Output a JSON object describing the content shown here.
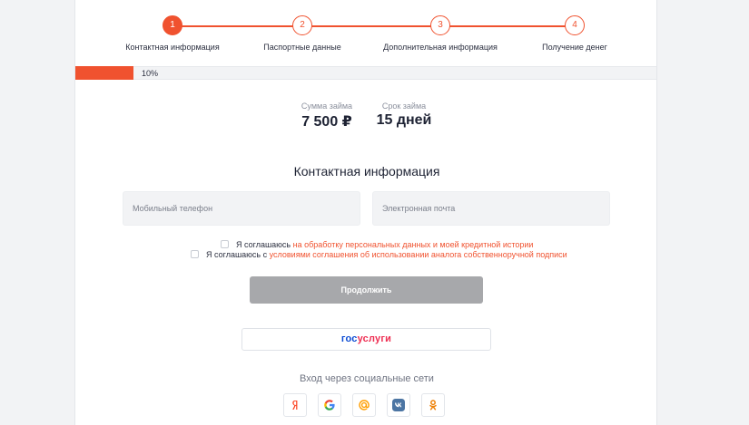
{
  "stepper": {
    "steps": [
      {
        "number": "1",
        "label": "Контактная информация"
      },
      {
        "number": "2",
        "label": "Паспортные данные"
      },
      {
        "number": "3",
        "label": "Дополнительная информация"
      },
      {
        "number": "4",
        "label": "Получение денег"
      }
    ],
    "active_step": 1
  },
  "progress": {
    "value": 0.1,
    "label": "10%"
  },
  "loan": {
    "amount_label": "Сумма займа",
    "amount_value": "7 500 ₽",
    "term_label": "Срок займа",
    "term_value": "15 дней"
  },
  "form": {
    "title": "Контактная информация",
    "phone_placeholder": "Мобильный телефон",
    "email_placeholder": "Электронная почта",
    "consent1_text": "Я соглашаюсь ",
    "consent1_link": "на обработку персональных данных и моей кредитной истории",
    "consent2_text": "Я соглашаюсь с ",
    "consent2_link": "условиями соглашения об использовании аналога собственноручной подписи",
    "continue_label": "Продолжить"
  },
  "gosuslugi": {
    "part1": "гос",
    "part2": "услуги"
  },
  "social": {
    "title": "Вход через социальные сети",
    "networks": [
      "yandex-icon",
      "google-icon",
      "mailru-icon",
      "vk-icon",
      "odnoklassniki-icon"
    ]
  },
  "colors": {
    "accent": "#f0522f",
    "button_disabled": "#a7a8ab",
    "gos_blue": "#0d4cd3",
    "gos_red": "#ee2f53"
  }
}
